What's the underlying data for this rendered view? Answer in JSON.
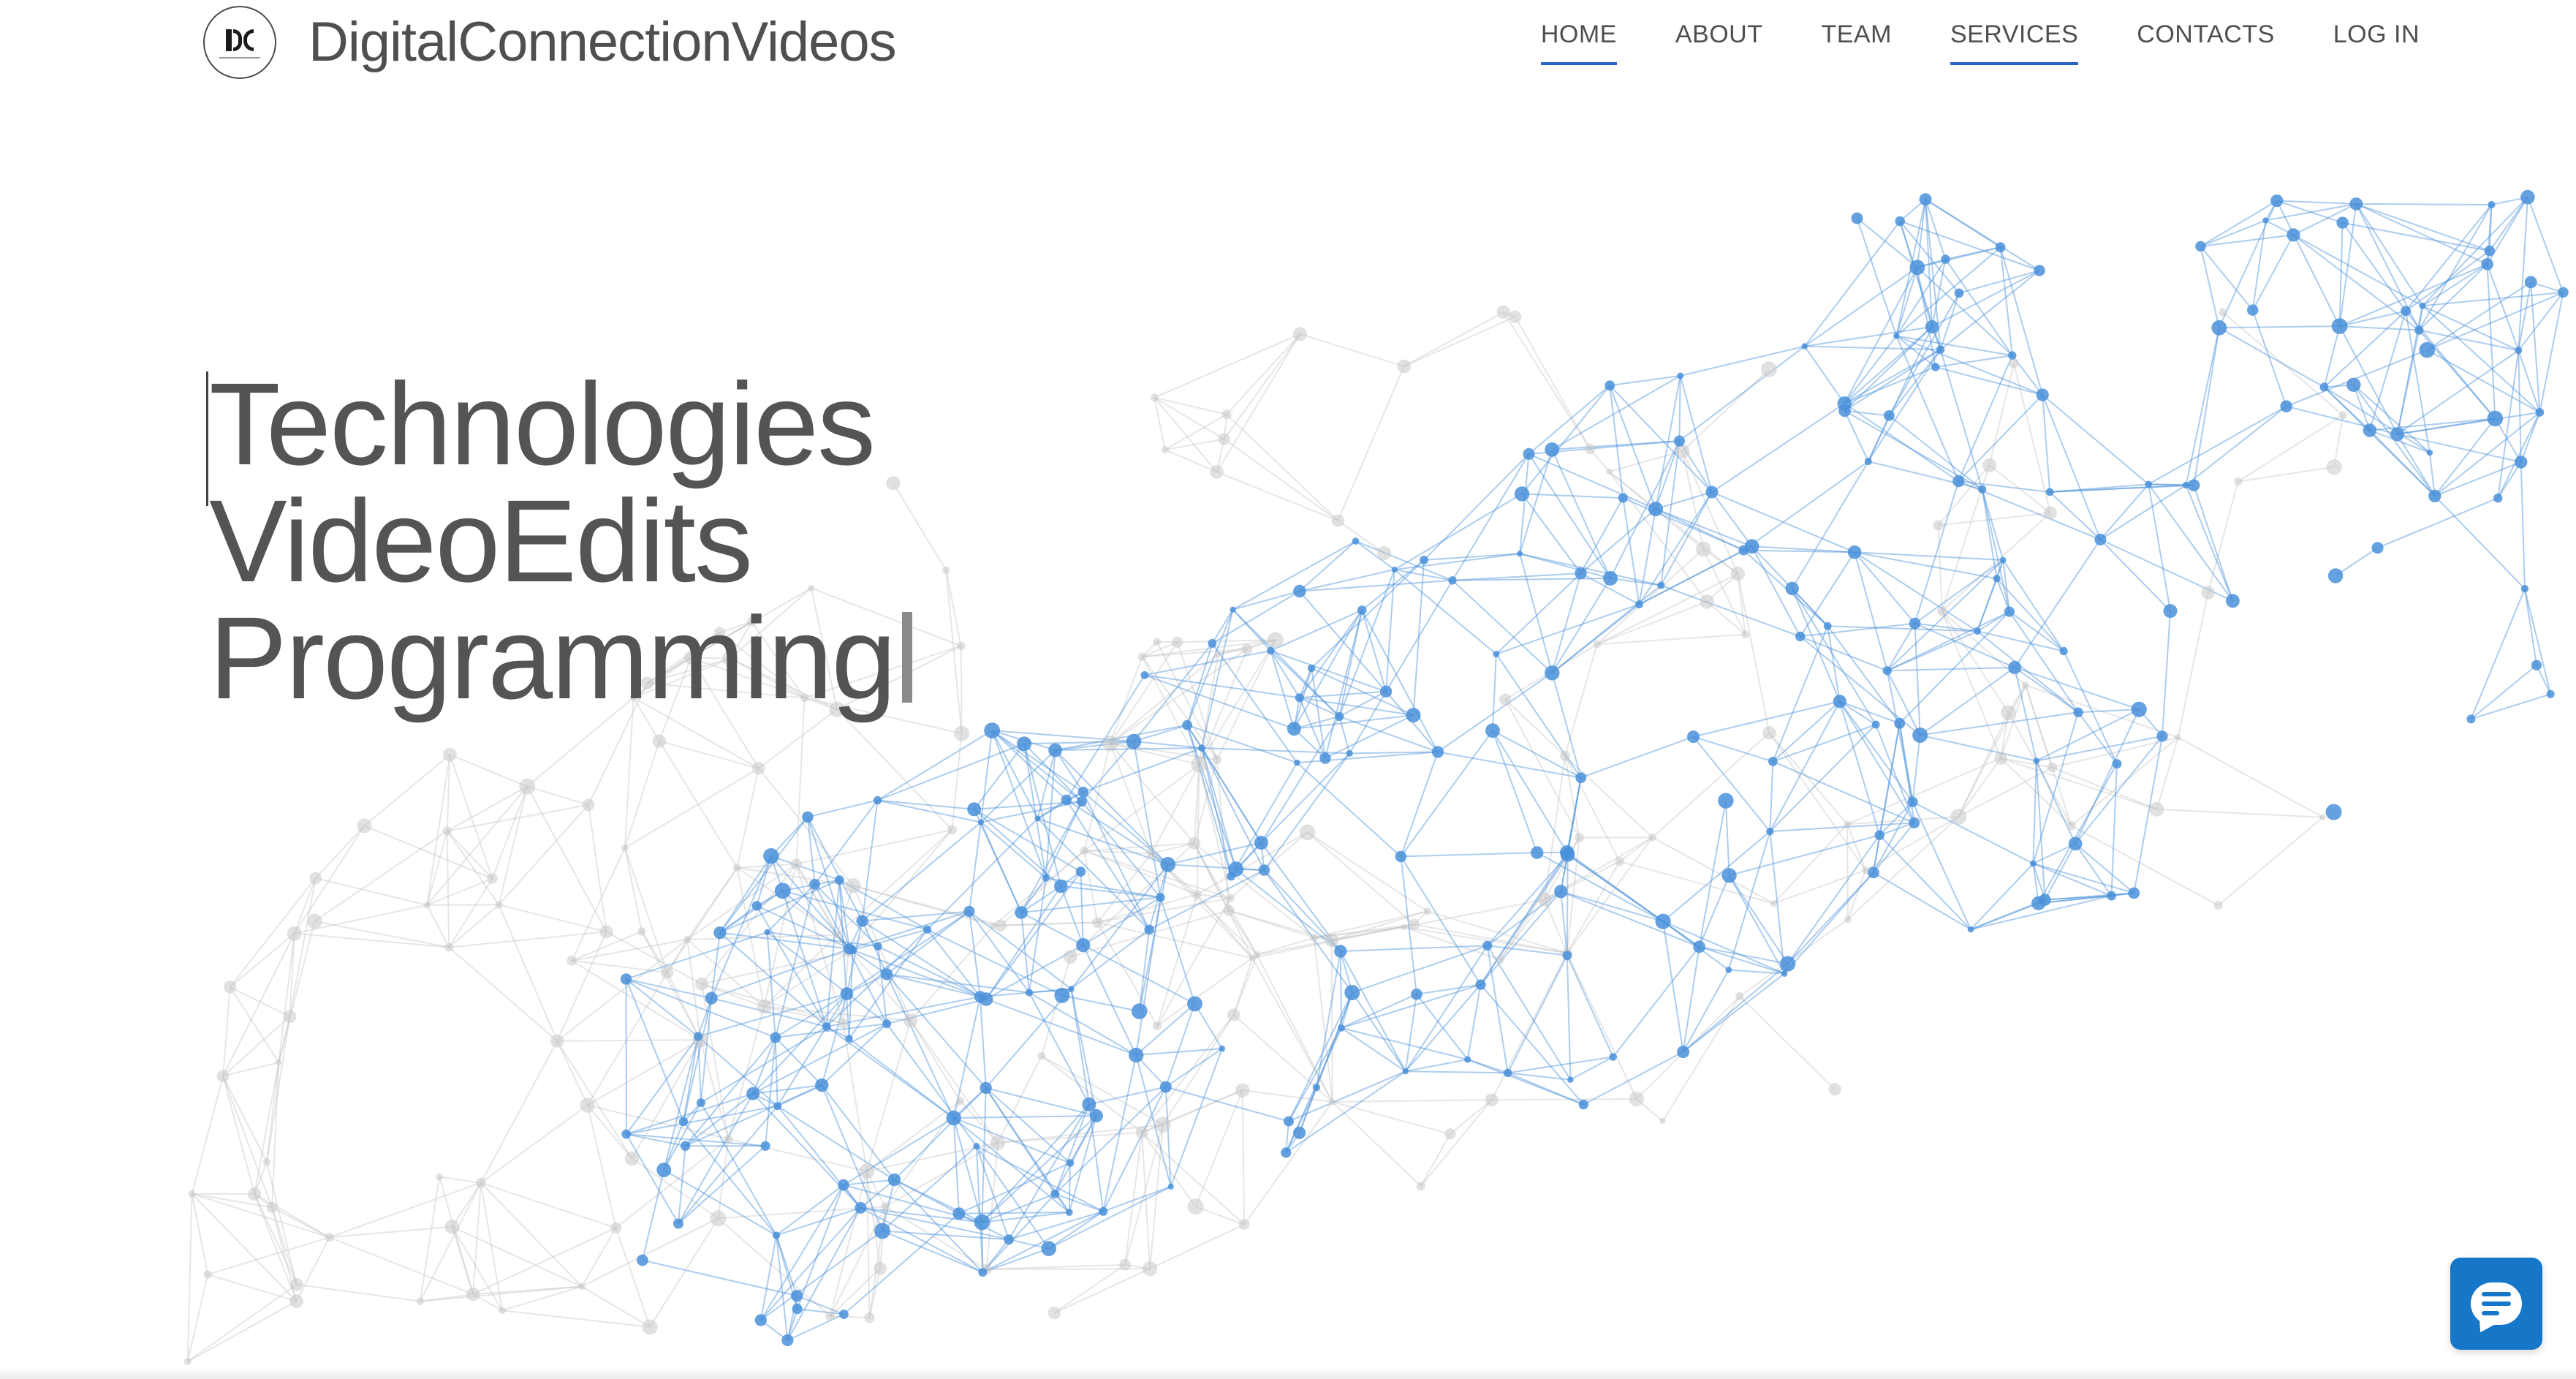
{
  "header": {
    "brand_name": "DigitalConnectionVideos",
    "logo_icon": "dc-logo-icon",
    "nav": [
      {
        "label": "HOME",
        "active": true
      },
      {
        "label": "ABOUT",
        "active": false
      },
      {
        "label": "TEAM",
        "active": false
      },
      {
        "label": "SERVICES",
        "active": true
      },
      {
        "label": "CONTACTS",
        "active": false
      },
      {
        "label": "LOG IN",
        "active": false
      }
    ]
  },
  "hero": {
    "lines": [
      "Technologies",
      "VideoEdits",
      "Programming"
    ]
  },
  "chat": {
    "icon": "chat-bubble-icon"
  },
  "colors": {
    "accent": "#2a62c9",
    "chat_button": "#1677c9",
    "text": "#545454",
    "network_blue": "#4a90d9",
    "network_gray": "#c8c8c8"
  }
}
